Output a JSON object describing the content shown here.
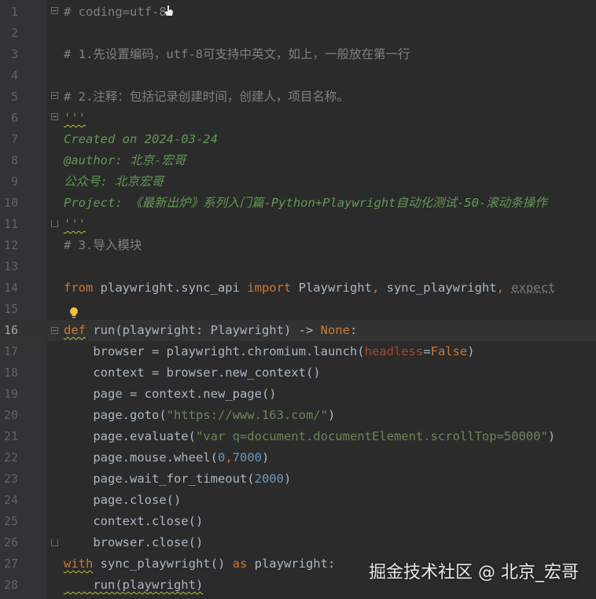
{
  "editor": {
    "active_line": 16,
    "lines": [
      {
        "n": "1",
        "tokens": [
          {
            "t": "# coding=utf-8",
            "c": "cm"
          }
        ]
      },
      {
        "n": "2",
        "tokens": []
      },
      {
        "n": "3",
        "tokens": [
          {
            "t": "# 1.先设置编码，utf-8可支持中英文，如上，一般放在第一行",
            "c": "cm"
          }
        ]
      },
      {
        "n": "4",
        "tokens": []
      },
      {
        "n": "5",
        "tokens": [
          {
            "t": "# 2.注释：包括记录创建时间，创建人，项目名称。",
            "c": "cm"
          }
        ]
      },
      {
        "n": "6",
        "tokens": [
          {
            "t": "'''",
            "c": "doc"
          }
        ]
      },
      {
        "n": "7",
        "tokens": [
          {
            "t": "Created on 2024-03-24",
            "c": "doc"
          }
        ]
      },
      {
        "n": "8",
        "tokens": [
          {
            "t": "@author: 北京-宏哥",
            "c": "doc"
          }
        ]
      },
      {
        "n": "9",
        "tokens": [
          {
            "t": "公众号: 北京宏哥",
            "c": "doc"
          }
        ]
      },
      {
        "n": "10",
        "tokens": [
          {
            "t": "Project: 《最新出炉》系列入门篇-Python+Playwright自动化测试-50-滚动条操作",
            "c": "doc"
          }
        ]
      },
      {
        "n": "11",
        "tokens": [
          {
            "t": "'''",
            "c": "doc"
          }
        ]
      },
      {
        "n": "12",
        "tokens": [
          {
            "t": "# 3.导入模块",
            "c": "cm"
          }
        ]
      },
      {
        "n": "13",
        "tokens": []
      },
      {
        "n": "14",
        "tokens": [
          {
            "t": "from",
            "c": "kw"
          },
          {
            "t": " playwright.sync_api ",
            "c": "plain"
          },
          {
            "t": "import",
            "c": "kw"
          },
          {
            "t": " Playwright",
            "c": "plain"
          },
          {
            "t": ",",
            "c": "kw"
          },
          {
            "t": " sync_playwright",
            "c": "plain"
          },
          {
            "t": ",",
            "c": "kw"
          },
          {
            "t": " ",
            "c": "plain"
          },
          {
            "t": "expect",
            "c": "faded"
          }
        ]
      },
      {
        "n": "15",
        "tokens": []
      },
      {
        "n": "16",
        "tokens": [
          {
            "t": "def",
            "c": "kw"
          },
          {
            "t": " run(playwright: Playwright) -> ",
            "c": "plain"
          },
          {
            "t": "None",
            "c": "kw"
          },
          {
            "t": ":",
            "c": "plain"
          }
        ]
      },
      {
        "n": "17",
        "tokens": [
          {
            "t": "    browser = playwright.chromium.launch(",
            "c": "plain"
          },
          {
            "t": "headless",
            "c": "param"
          },
          {
            "t": "=",
            "c": "plain"
          },
          {
            "t": "False",
            "c": "kw"
          },
          {
            "t": ")",
            "c": "plain"
          }
        ]
      },
      {
        "n": "18",
        "tokens": [
          {
            "t": "    context = browser.new_context()",
            "c": "plain"
          }
        ]
      },
      {
        "n": "19",
        "tokens": [
          {
            "t": "    page = context.new_page()",
            "c": "plain"
          }
        ]
      },
      {
        "n": "20",
        "tokens": [
          {
            "t": "    page.goto(",
            "c": "plain"
          },
          {
            "t": "\"https://www.163.com/\"",
            "c": "str"
          },
          {
            "t": ")",
            "c": "plain"
          }
        ]
      },
      {
        "n": "21",
        "tokens": [
          {
            "t": "    page.evaluate(",
            "c": "plain"
          },
          {
            "t": "\"var q=document.documentElement.scrollTop=50000\"",
            "c": "str"
          },
          {
            "t": ")",
            "c": "plain"
          }
        ]
      },
      {
        "n": "22",
        "tokens": [
          {
            "t": "    page.mouse.wheel(",
            "c": "plain"
          },
          {
            "t": "0",
            "c": "num"
          },
          {
            "t": ",",
            "c": "kw"
          },
          {
            "t": "7000",
            "c": "num"
          },
          {
            "t": ")",
            "c": "plain"
          }
        ]
      },
      {
        "n": "23",
        "tokens": [
          {
            "t": "    page.wait_for_timeout(",
            "c": "plain"
          },
          {
            "t": "2000",
            "c": "num"
          },
          {
            "t": ")",
            "c": "plain"
          }
        ]
      },
      {
        "n": "24",
        "tokens": [
          {
            "t": "    page.close()",
            "c": "plain"
          }
        ]
      },
      {
        "n": "25",
        "tokens": [
          {
            "t": "    context.close()",
            "c": "plain"
          }
        ]
      },
      {
        "n": "26",
        "tokens": [
          {
            "t": "    browser.close()",
            "c": "plain"
          }
        ]
      },
      {
        "n": "27",
        "tokens": [
          {
            "t": "with",
            "c": "kw"
          },
          {
            "t": " sync_playwright() ",
            "c": "plain"
          },
          {
            "t": "as",
            "c": "kw"
          },
          {
            "t": " playwright:",
            "c": "plain"
          }
        ]
      },
      {
        "n": "28",
        "tokens": [
          {
            "t": "    run(playwright)",
            "c": "plain"
          }
        ]
      }
    ]
  },
  "watermark": "掘金技术社区 @ 北京_宏哥",
  "colors": {
    "background": "#2b2b2b",
    "gutter": "#313335",
    "keyword": "#cc7832",
    "comment": "#808080",
    "docstring": "#629755",
    "string": "#6a8759",
    "number": "#6897bb",
    "param": "#aa4926",
    "text": "#a9b7c6"
  },
  "icons": [
    "intention-bulb-icon",
    "fold-marker-icon",
    "hand-cursor-icon"
  ]
}
